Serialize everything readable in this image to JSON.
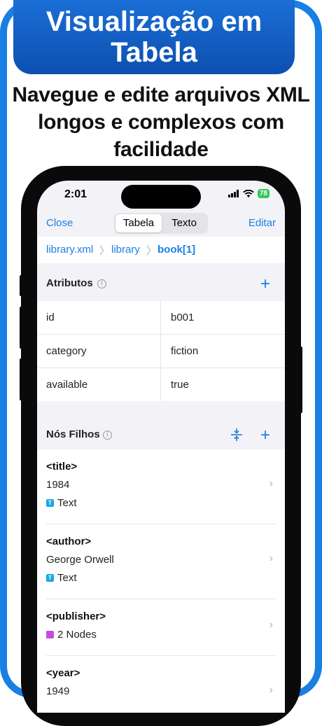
{
  "banner": {
    "title": "Visualização em Tabela"
  },
  "subtitle": "Navegue e edite arquivos XML longos e complexos com facilidade",
  "status_bar": {
    "time": "2:01",
    "battery": "78"
  },
  "navbar": {
    "close": "Close",
    "edit": "Editar",
    "tabs": [
      {
        "label": "Tabela",
        "active": true
      },
      {
        "label": "Texto",
        "active": false
      }
    ]
  },
  "breadcrumb": [
    {
      "label": "library.xml"
    },
    {
      "label": "library"
    },
    {
      "label": "book[1]"
    }
  ],
  "attributes": {
    "title": "Atributos",
    "rows": [
      {
        "key": "id",
        "value": "b001"
      },
      {
        "key": "category",
        "value": "fiction"
      },
      {
        "key": "available",
        "value": "true"
      }
    ]
  },
  "children": {
    "title": "Nós Filhos",
    "items": [
      {
        "tag": "<title>",
        "value": "1984",
        "type": "Text",
        "type_color": "#1aa7e8",
        "type_glyph": "T"
      },
      {
        "tag": "<author>",
        "value": "George Orwell",
        "type": "Text",
        "type_color": "#1aa7e8",
        "type_glyph": "T"
      },
      {
        "tag": "<publisher>",
        "value": "",
        "type": "2 Nodes",
        "type_color": "#c04fe0",
        "type_glyph": ""
      },
      {
        "tag": "<year>",
        "value": "1949",
        "type": "",
        "type_color": "",
        "type_glyph": ""
      }
    ]
  },
  "colors": {
    "accent": "#1a7fe3",
    "banner": "#0d4fb0"
  }
}
